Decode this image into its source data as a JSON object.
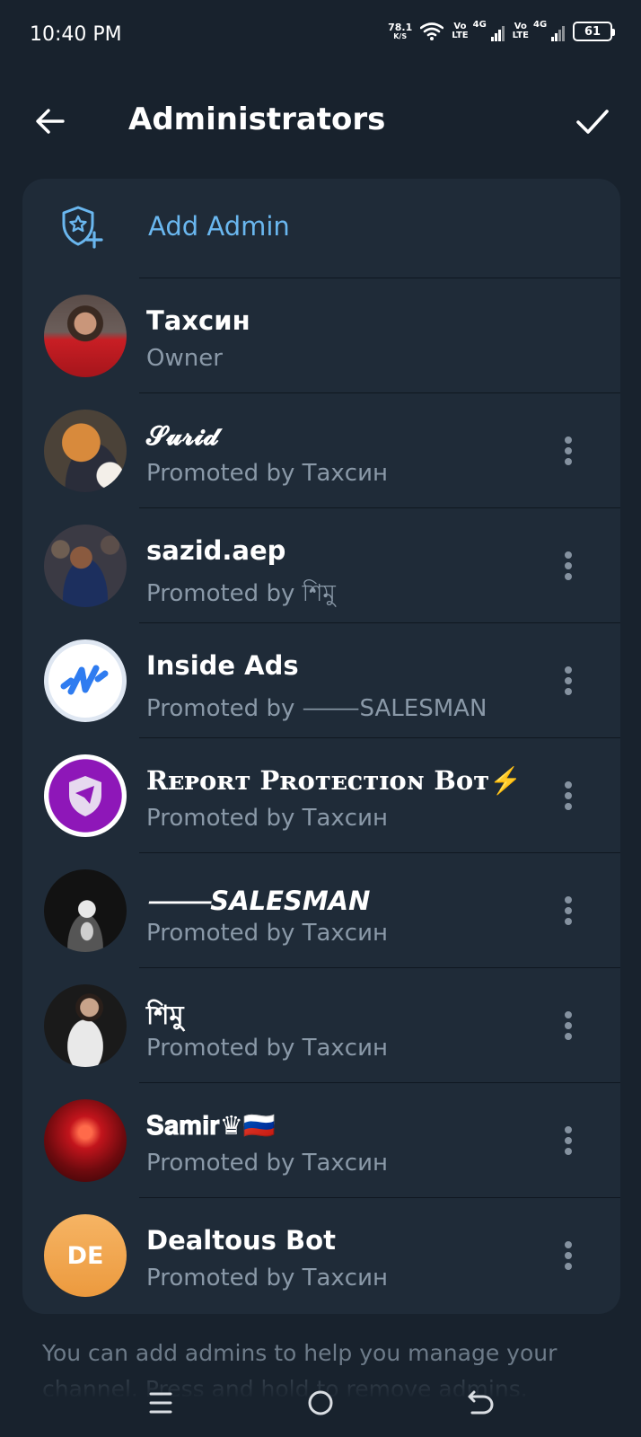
{
  "status_bar": {
    "time": "10:40 PM",
    "net_speed": "78.1",
    "net_unit": "K/S",
    "volte_top": "Vo",
    "volte_bottom": "LTE",
    "network_gen": "4G",
    "battery": "61"
  },
  "header": {
    "title": "Administrators",
    "back_icon": "arrow-left-icon",
    "confirm_icon": "check-icon"
  },
  "add_admin": {
    "label": "Add Admin",
    "icon": "shield-star-plus-icon",
    "color": "#6ab7ef"
  },
  "admins": [
    {
      "name": "Тахсин",
      "subtitle": "Owner",
      "avatar": "photo",
      "has_menu": false
    },
    {
      "name": "𝓢𝓾𝓻𝓲𝓭",
      "subtitle": "Promoted by Тахсин",
      "avatar": "photo",
      "has_menu": true
    },
    {
      "name": "sazid.aep",
      "subtitle": "Promoted by শিমু",
      "avatar": "photo",
      "has_menu": true
    },
    {
      "name": "Inside Ads",
      "subtitle": "Promoted by ⸻SALESMAN",
      "avatar": "logo",
      "has_menu": true
    },
    {
      "name": "Rᴇᴘᴏʀᴛ Pʀᴏᴛᴇᴄᴛɪᴏɴ Bᴏᴛ⚡",
      "subtitle": "Promoted by Тахсин",
      "avatar": "logo",
      "has_menu": true
    },
    {
      "name": "⸻SALESMAN",
      "subtitle": "Promoted by Тахсин",
      "avatar": "photo",
      "has_menu": true
    },
    {
      "name": "শিমু",
      "subtitle": "Promoted by Тахсин",
      "avatar": "photo",
      "has_menu": true
    },
    {
      "name": "𝐒𝐚𝐦𝐢𝐫♛🇷🇺",
      "subtitle": "Promoted by Тахсин",
      "avatar": "photo",
      "has_menu": true
    },
    {
      "name": "Dealtous Bot",
      "subtitle": "Promoted by Тахсин",
      "avatar": "initials",
      "initials": "DE",
      "has_menu": true
    }
  ],
  "footer": {
    "text": "You can add admins to help you manage your channel. Press and hold to remove admins."
  },
  "nav": {
    "menu_icon": "menu-icon",
    "home_icon": "home-circle-icon",
    "back_icon": "back-return-icon"
  },
  "colors": {
    "background": "#18222d",
    "card": "#1f2b38",
    "accent": "#6ab7ef",
    "secondary_text": "#8a99a8",
    "initials_avatar": "#f0a04b"
  }
}
